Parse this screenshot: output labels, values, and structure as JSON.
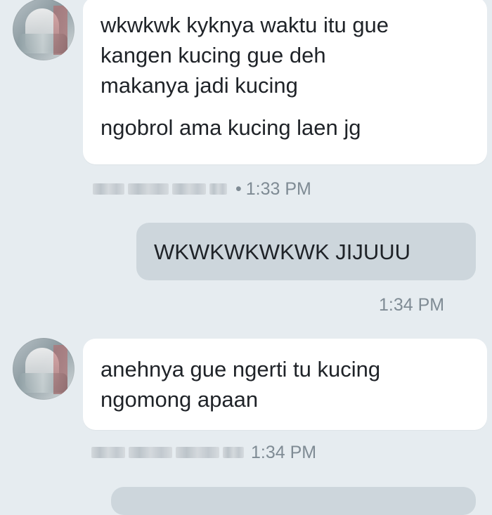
{
  "messages": [
    {
      "side": "left",
      "lines": [
        "wkwkwk kyknya waktu itu gue",
        "kangen kucing gue deh",
        "makanya jadi kucing"
      ],
      "extra_line": "ngobrol ama kucing laen jg",
      "sender_name": "",
      "separator": "•",
      "time": "1:33 PM"
    },
    {
      "side": "right",
      "lines": [
        "WKWKWKWKWK JIJUUU"
      ],
      "time": "1:34 PM"
    },
    {
      "side": "left",
      "lines": [
        "anehnya gue ngerti tu kucing",
        "ngomong apaan"
      ],
      "sender_name": "",
      "time": "1:34 PM"
    }
  ],
  "colors": {
    "background": "#e6ecf0",
    "incoming_bubble": "#ffffff",
    "outgoing_bubble": "#cdd6dc",
    "meta_text": "#7f8b94"
  },
  "icons": {
    "avatar": "profile-photo-blurred",
    "name_redaction": "blurred-name"
  }
}
